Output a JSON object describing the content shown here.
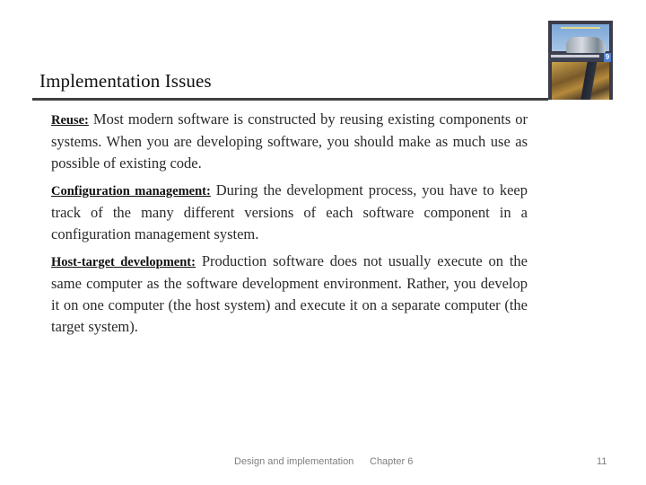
{
  "slide": {
    "title": "Implementation Issues",
    "cover_image": {
      "alt": "Software Engineering 9th edition book cover",
      "edition_mark": "9"
    },
    "paragraphs": [
      {
        "term": "Reuse:",
        "text": " Most modern software is constructed by reusing existing components or systems. When you are developing software, you should make as much use as possible of existing code."
      },
      {
        "term": "Configuration management:",
        "text": " During the development process, you have to keep track of the many different versions of each software component in a configuration management system."
      },
      {
        "term": "Host-target development:",
        "text": " Production software does not usually execute on the same computer as the software development environment. Rather, you develop it on one computer (the host system) and execute it on a separate computer (the target system)."
      }
    ]
  },
  "footer": {
    "section": "Design and implementation",
    "chapter": "Chapter 6",
    "page_number": "11"
  },
  "colors": {
    "title_rule": "#404040",
    "footer_text": "#7f7f7f",
    "body_text": "#2a2a2a"
  }
}
